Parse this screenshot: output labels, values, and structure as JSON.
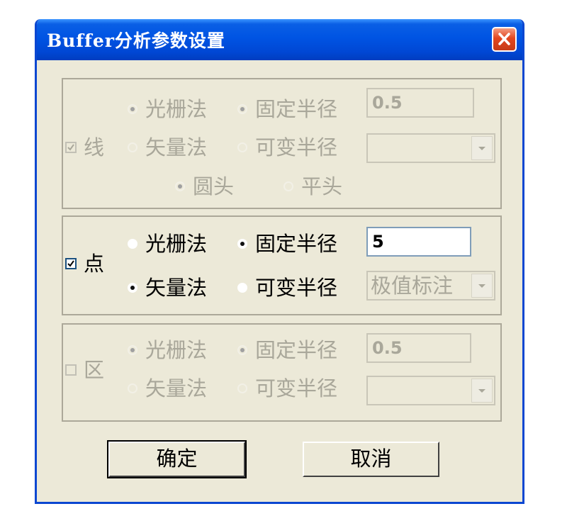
{
  "window": {
    "title": "Buffer分析参数设置"
  },
  "groups": {
    "line": {
      "checkbox_label": "线",
      "checked": true,
      "enabled": false,
      "radio_raster": "光栅法",
      "radio_vector": "矢量法",
      "radio_fixed_radius": "固定半径",
      "radio_variable_radius": "可变半径",
      "radius_value": "0.5",
      "radio_round_end": "圆头",
      "radio_flat_end": "平头",
      "variable_select_value": ""
    },
    "point": {
      "checkbox_label": "点",
      "checked": true,
      "enabled": true,
      "radio_raster": "光栅法",
      "radio_vector": "矢量法",
      "radio_fixed_radius": "固定半径",
      "radio_variable_radius": "可变半径",
      "radius_value": "5",
      "variable_select_value": "极值标注"
    },
    "area": {
      "checkbox_label": "区",
      "checked": false,
      "enabled": false,
      "radio_raster": "光栅法",
      "radio_vector": "矢量法",
      "radio_fixed_radius": "固定半径",
      "radio_variable_radius": "可变半径",
      "radius_value": "0.5",
      "variable_select_value": ""
    }
  },
  "buttons": {
    "ok_label": "确定",
    "cancel_label": "取消"
  },
  "icons": {
    "close": "close-icon",
    "dropdown": "chevron-down-icon",
    "check": "check-icon"
  },
  "colors": {
    "titlebar": "#0054e3",
    "dialog_bg": "#ece9d8",
    "disabled_text": "#a9a79a",
    "close_button": "#e2461f"
  }
}
